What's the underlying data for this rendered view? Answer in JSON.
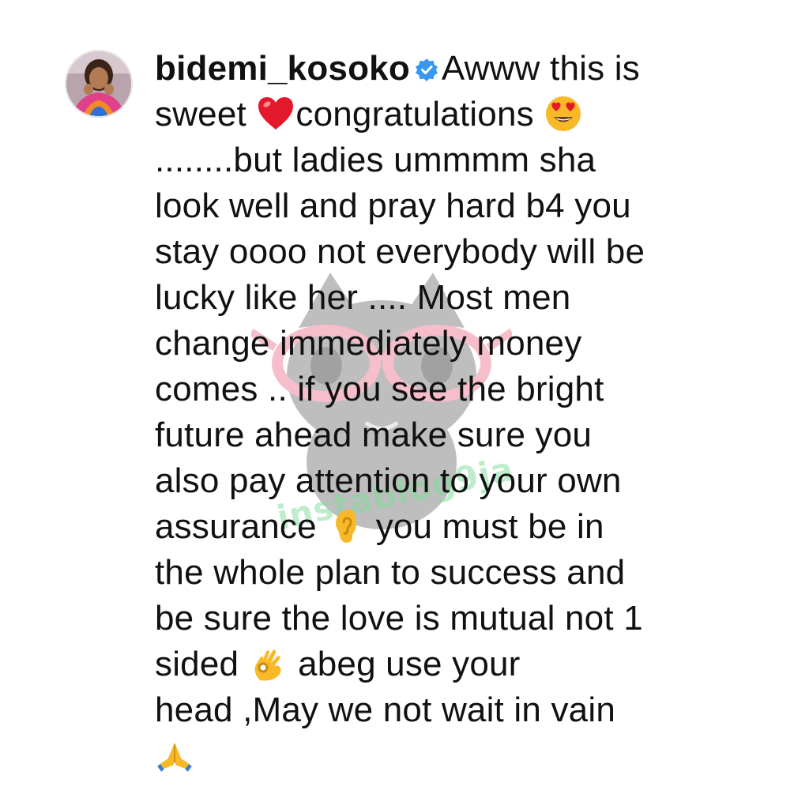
{
  "comment": {
    "username": "bidemi_kosoko",
    "verified": true,
    "lines": [
      "Awww this is",
      "sweet",
      "congratulations",
      "........but ladies ummmm sha",
      "look well and pray hard  b4 you",
      "stay oooo not everybody will be",
      "lucky like her .... Most men",
      "change immediately money",
      "comes .. if you see the bright",
      "future ahead make sure you",
      "also pay attention to your own",
      "assurance",
      "you must be in",
      "the whole plan to success and",
      "be sure the love is mutual not 1",
      "sided",
      "abeg use your",
      "head ,May we not wait in vain"
    ],
    "emojis": [
      "red-heart",
      "heart-eyes",
      "ear",
      "ok-hand",
      "folded-hands"
    ]
  },
  "watermark": {
    "text": "instablog9ja"
  },
  "colors": {
    "text": "#111111",
    "verified_badge": "#3897f0",
    "watermark_glasses": "#f08aa0",
    "watermark_cat": "#8a8a8a",
    "watermark_text": "#7fdc9a"
  }
}
